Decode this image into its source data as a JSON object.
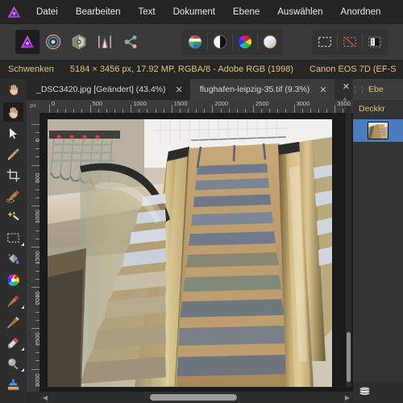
{
  "app": {
    "name": "Affinity Photo",
    "logo_icon": "affinity-logo-icon"
  },
  "menubar": {
    "items": [
      {
        "label": "Datei",
        "name": "menu-datei"
      },
      {
        "label": "Bearbeiten",
        "name": "menu-bearbeiten"
      },
      {
        "label": "Text",
        "name": "menu-text"
      },
      {
        "label": "Dokument",
        "name": "menu-dokument"
      },
      {
        "label": "Ebene",
        "name": "menu-ebene"
      },
      {
        "label": "Auswählen",
        "name": "menu-auswaehlen"
      },
      {
        "label": "Anordnen",
        "name": "menu-anordnen"
      }
    ]
  },
  "toolbar": {
    "personas": [
      {
        "name": "persona-photo",
        "icon": "affinity-photo-persona-icon",
        "active": true
      },
      {
        "name": "persona-liquify",
        "icon": "liquify-persona-icon",
        "active": false
      },
      {
        "name": "persona-develop",
        "icon": "develop-persona-icon",
        "active": false
      },
      {
        "name": "persona-tone-mapping",
        "icon": "tone-mapping-persona-icon",
        "active": false
      },
      {
        "name": "persona-export",
        "icon": "export-persona-icon",
        "active": false
      }
    ],
    "adjustments": [
      {
        "name": "channels-adjustment-button",
        "icon": "channels-icon"
      },
      {
        "name": "black-white-adjustment-button",
        "icon": "black-white-circle-icon"
      },
      {
        "name": "color-wheel-adjustment-button",
        "icon": "color-wheel-icon"
      },
      {
        "name": "gradient-adjustment-button",
        "icon": "gradient-sphere-icon"
      }
    ],
    "selection_tools": [
      {
        "name": "marquee-selection-button",
        "icon": "dashed-rectangle-icon"
      },
      {
        "name": "deselect-button",
        "icon": "dashed-rectangle-slash-icon"
      },
      {
        "name": "refine-selection-button",
        "icon": "refine-selection-icon"
      }
    ]
  },
  "context_bar": {
    "tool_name": "Schwenken",
    "image_info": "5184 × 3456 px, 17.92 MP, RGBA/8 - Adobe RGB (1998)",
    "camera_info": "Canon EOS 7D (EF-S"
  },
  "tabs": {
    "hand_tool_icon": "hand-icon",
    "documents": [
      {
        "title": "_DSC3420.jpg [Geändert] (43.4%)",
        "active": false,
        "close_label": "✕"
      },
      {
        "title": "flughafen-leipzig-35.tif (9.3%)",
        "active": true,
        "close_label": "✕"
      }
    ]
  },
  "tools": {
    "items": [
      {
        "name": "tool-hand",
        "icon": "hand-icon",
        "selected": true,
        "has_flyout": false
      },
      {
        "name": "tool-move",
        "icon": "cursor-arrow-icon",
        "selected": false,
        "has_flyout": false
      },
      {
        "name": "tool-color-picker",
        "icon": "eyedropper-icon",
        "selected": false,
        "has_flyout": false
      },
      {
        "name": "tool-crop",
        "icon": "crop-icon",
        "selected": false,
        "has_flyout": false
      },
      {
        "name": "tool-selection-brush",
        "icon": "selection-brush-icon",
        "selected": false,
        "has_flyout": false
      },
      {
        "name": "tool-magic-wand",
        "icon": "magic-wand-icon",
        "selected": false,
        "has_flyout": false
      },
      {
        "name": "tool-marquee",
        "icon": "dashed-rectangle-icon",
        "selected": false,
        "has_flyout": true
      },
      {
        "name": "tool-paint-bucket",
        "icon": "paint-bucket-icon",
        "selected": false,
        "has_flyout": false
      },
      {
        "name": "tool-color-wheel",
        "icon": "color-wheel-palette-icon",
        "selected": false,
        "has_flyout": false
      },
      {
        "name": "tool-paint-brush",
        "icon": "paint-brush-icon",
        "selected": false,
        "has_flyout": true
      },
      {
        "name": "tool-smudge-brush",
        "icon": "smudge-brush-icon",
        "selected": false,
        "has_flyout": false
      },
      {
        "name": "tool-eraser",
        "icon": "eraser-icon",
        "selected": false,
        "has_flyout": true
      },
      {
        "name": "tool-blur",
        "icon": "blur-tool-icon",
        "selected": false,
        "has_flyout": true
      },
      {
        "name": "tool-clone-stamp",
        "icon": "clone-stamp-icon",
        "selected": false,
        "has_flyout": false
      }
    ]
  },
  "rulers": {
    "unit_label": "px",
    "horizontal_labels": [
      "0",
      "500",
      "1000",
      "1500",
      "2000",
      "2500",
      "3000",
      "3500"
    ],
    "vertical_labels": [
      "0",
      "500",
      "1000",
      "1500",
      "2000",
      "2500",
      "3000"
    ]
  },
  "canvas": {
    "document_title": "flughafen-leipzig-35.tif",
    "scroll_up_arrow": "▲",
    "scroll_left_arrow": "◀",
    "scroll_right_arrow": "▶"
  },
  "right_panel": {
    "close_label": "✕",
    "tab_handle_icon": "drag-handle-icon",
    "tab_label": "Ebe",
    "opacity_label": "Deckkr",
    "layer": {
      "name": "layer-row-1",
      "thumbnail_icon": "layer-thumbnail"
    },
    "bottom_icon": "layers-stack-icon"
  },
  "colors": {
    "accent_gold": "#e2c07a",
    "selection_blue": "#4a7cbe",
    "menu_bg": "#242424",
    "toolbar_bg": "#3a3a3a",
    "panel_bg": "#2e2e2e",
    "canvas_bg": "#1b1b1b"
  }
}
